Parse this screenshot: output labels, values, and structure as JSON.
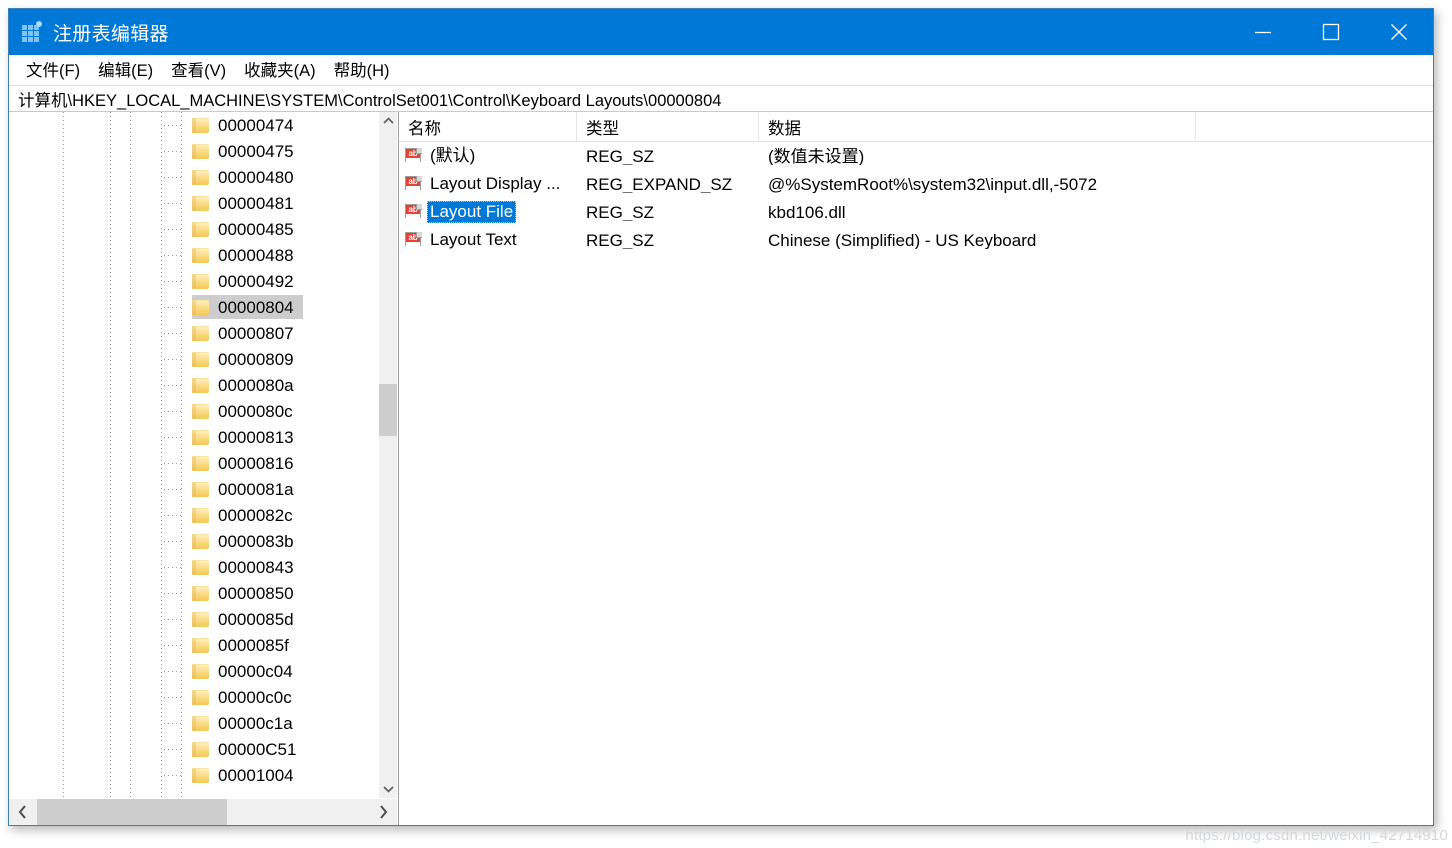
{
  "window": {
    "title": "注册表编辑器",
    "icon": "registry-grid-icon",
    "accent_color": "#0078d7",
    "border_color": "#3c7fb1",
    "controls": {
      "minimize_label": "最小化",
      "maximize_label": "最大化",
      "close_label": "关闭"
    }
  },
  "menubar": {
    "items": [
      {
        "label": "文件(F)",
        "name": "file"
      },
      {
        "label": "编辑(E)",
        "name": "edit"
      },
      {
        "label": "查看(V)",
        "name": "view"
      },
      {
        "label": "收藏夹(A)",
        "name": "favorites"
      },
      {
        "label": "帮助(H)",
        "name": "help"
      }
    ]
  },
  "address": {
    "path": "计算机\\HKEY_LOCAL_MACHINE\\SYSTEM\\ControlSet001\\Control\\Keyboard Layouts\\00000804"
  },
  "tree": {
    "selected": "00000804",
    "selection_color": "#cdcdcd",
    "nodes": [
      {
        "label": "00000474"
      },
      {
        "label": "00000475"
      },
      {
        "label": "00000480"
      },
      {
        "label": "00000481"
      },
      {
        "label": "00000485"
      },
      {
        "label": "00000488"
      },
      {
        "label": "00000492"
      },
      {
        "label": "00000804",
        "selected": true
      },
      {
        "label": "00000807"
      },
      {
        "label": "00000809"
      },
      {
        "label": "0000080a"
      },
      {
        "label": "0000080c"
      },
      {
        "label": "00000813"
      },
      {
        "label": "00000816"
      },
      {
        "label": "0000081a"
      },
      {
        "label": "0000082c"
      },
      {
        "label": "0000083b"
      },
      {
        "label": "00000843"
      },
      {
        "label": "00000850"
      },
      {
        "label": "0000085d"
      },
      {
        "label": "0000085f"
      },
      {
        "label": "00000c04"
      },
      {
        "label": "00000c0c"
      },
      {
        "label": "00000c1a"
      },
      {
        "label": "00000C51"
      },
      {
        "label": "00001004"
      }
    ]
  },
  "values": {
    "columns": [
      {
        "label": "名称",
        "name": "name"
      },
      {
        "label": "类型",
        "name": "type"
      },
      {
        "label": "数据",
        "name": "data"
      }
    ],
    "selected_name": "Layout File",
    "selection_color": "#0078d7",
    "rows": [
      {
        "name": "(默认)",
        "type": "REG_SZ",
        "data": "(数值未设置)",
        "icon": "string-value-icon",
        "selected": false
      },
      {
        "name": "Layout Display ...",
        "type": "REG_EXPAND_SZ",
        "data": "@%SystemRoot%\\system32\\input.dll,-5072",
        "icon": "string-value-icon",
        "selected": false
      },
      {
        "name": "Layout File",
        "type": "REG_SZ",
        "data": "kbd106.dll",
        "icon": "string-value-icon",
        "selected": true
      },
      {
        "name": "Layout Text",
        "type": "REG_SZ",
        "data": "Chinese (Simplified) - US Keyboard",
        "icon": "string-value-icon",
        "selected": false
      }
    ]
  },
  "watermark": {
    "text": "https://blog.csdn.net/weixin_42714910"
  }
}
